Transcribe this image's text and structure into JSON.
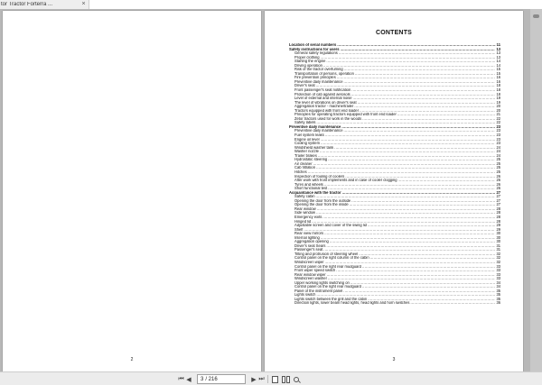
{
  "tab": {
    "title": "tor Tractor Forterra ...",
    "close": "×"
  },
  "left_page": {
    "number": "2"
  },
  "right_page": {
    "number": "3",
    "title": "CONTENTS",
    "toc": [
      {
        "text": "Location of serial numbers",
        "page": "11",
        "section": true,
        "indent": false
      },
      {
        "text": "Safety instructions for users",
        "page": "13",
        "section": true,
        "indent": false
      },
      {
        "text": "General safety regulations",
        "page": "13",
        "section": false,
        "indent": true
      },
      {
        "text": "Proper clothing",
        "page": "13",
        "section": false,
        "indent": true
      },
      {
        "text": "Starting the engine",
        "page": "14",
        "section": false,
        "indent": true
      },
      {
        "text": "Driving operation",
        "page": "14",
        "section": false,
        "indent": true
      },
      {
        "text": "Risk of the tractor overturning",
        "page": "15",
        "section": false,
        "indent": true
      },
      {
        "text": "Transportation of persons, operation",
        "page": "15",
        "section": false,
        "indent": true
      },
      {
        "text": "Fire prevention principles",
        "page": "16",
        "section": false,
        "indent": true
      },
      {
        "text": "Preventive daily maintenance",
        "page": "16",
        "section": false,
        "indent": true
      },
      {
        "text": "Driver's seat",
        "page": "18",
        "section": false,
        "indent": true
      },
      {
        "text": "Front passenger's seat notification",
        "page": "18",
        "section": false,
        "indent": true
      },
      {
        "text": "Protection of cab against aerosols",
        "page": "18",
        "section": false,
        "indent": true
      },
      {
        "text": "Level of external and internal noise",
        "page": "19",
        "section": false,
        "indent": true
      },
      {
        "text": "The level of vibrations on driver's seat",
        "page": "19",
        "section": false,
        "indent": true
      },
      {
        "text": "Aggregation tractor - machine/trailer",
        "page": "20",
        "section": false,
        "indent": true
      },
      {
        "text": "Tractors equipped with front end loader",
        "page": "20",
        "section": false,
        "indent": true
      },
      {
        "text": "Principles for operating tractors equipped with front end loader",
        "page": "21",
        "section": false,
        "indent": true
      },
      {
        "text": "Zetor tractors used for work in the woods",
        "page": "22",
        "section": false,
        "indent": true
      },
      {
        "text": "Safety labels",
        "page": "22",
        "section": false,
        "indent": true
      },
      {
        "text": "Preventive daily maintenance",
        "page": "23",
        "section": true,
        "indent": false
      },
      {
        "text": "Preventive daily maintenance",
        "page": "23",
        "section": false,
        "indent": true
      },
      {
        "text": "Fuel system leaks",
        "page": "23",
        "section": false,
        "indent": true
      },
      {
        "text": "Engine oil level",
        "page": "23",
        "section": false,
        "indent": true
      },
      {
        "text": "Cooling system",
        "page": "23",
        "section": false,
        "indent": true
      },
      {
        "text": "Windshield washer tank",
        "page": "24",
        "section": false,
        "indent": true
      },
      {
        "text": "Washer nozzle",
        "page": "24",
        "section": false,
        "indent": true
      },
      {
        "text": "Trailer brakes",
        "page": "24",
        "section": false,
        "indent": true
      },
      {
        "text": "Hydrostatic steering",
        "page": "25",
        "section": false,
        "indent": true
      },
      {
        "text": "Air cleaner",
        "page": "25",
        "section": false,
        "indent": true
      },
      {
        "text": "Cab filtration",
        "page": "25",
        "section": false,
        "indent": true
      },
      {
        "text": "Hitches",
        "page": "25",
        "section": false,
        "indent": true
      },
      {
        "text": "Inspection of fouling of coolers",
        "page": "26",
        "section": false,
        "indent": true
      },
      {
        "text": "After work with front implements and in case of cooler clogging",
        "page": "26",
        "section": false,
        "indent": true
      },
      {
        "text": "Tyres and wheels",
        "page": "26",
        "section": false,
        "indent": true
      },
      {
        "text": "Short functional test",
        "page": "26",
        "section": false,
        "indent": true
      },
      {
        "text": "Acquaintance with the tractor",
        "page": "27",
        "section": true,
        "indent": false
      },
      {
        "text": "Safety cabin",
        "page": "27",
        "section": false,
        "indent": true
      },
      {
        "text": "Opening the door from the outside",
        "page": "27",
        "section": false,
        "indent": true
      },
      {
        "text": "Opening the door from the inside",
        "page": "27",
        "section": false,
        "indent": true
      },
      {
        "text": "Rear window",
        "page": "28",
        "section": false,
        "indent": true
      },
      {
        "text": "Side window",
        "page": "28",
        "section": false,
        "indent": true
      },
      {
        "text": "Emergency exits",
        "page": "28",
        "section": false,
        "indent": true
      },
      {
        "text": "Hinged lid",
        "page": "28",
        "section": false,
        "indent": true
      },
      {
        "text": "Adjustable screen and cover of the swing lid",
        "page": "29",
        "section": false,
        "indent": true
      },
      {
        "text": "Shelf",
        "page": "29",
        "section": false,
        "indent": true
      },
      {
        "text": "Rear view mirrors",
        "page": "30",
        "section": false,
        "indent": true
      },
      {
        "text": "Internal lighting",
        "page": "30",
        "section": false,
        "indent": true
      },
      {
        "text": "Aggregation opening",
        "page": "30",
        "section": false,
        "indent": true
      },
      {
        "text": "Driver's seat Sears",
        "page": "31",
        "section": false,
        "indent": true
      },
      {
        "text": "Passenger's seat",
        "page": "31",
        "section": false,
        "indent": true
      },
      {
        "text": "Tilting and protrusion of steering wheel",
        "page": "32",
        "section": false,
        "indent": true
      },
      {
        "text": "Control panel on the right column of the cabin",
        "page": "32",
        "section": false,
        "indent": true
      },
      {
        "text": "Windscreen wiper",
        "page": "32",
        "section": false,
        "indent": true
      },
      {
        "text": "Control panel on the right rear mudguard",
        "page": "33",
        "section": false,
        "indent": true
      },
      {
        "text": "Front wiper speed switch",
        "page": "33",
        "section": false,
        "indent": true
      },
      {
        "text": "Rear window wiper",
        "page": "33",
        "section": false,
        "indent": true
      },
      {
        "text": "Windscreen washer",
        "page": "33",
        "section": false,
        "indent": true
      },
      {
        "text": "Upper working lights switching on",
        "page": "34",
        "section": false,
        "indent": true
      },
      {
        "text": "Control panel on the right rear mudguard",
        "page": "34",
        "section": false,
        "indent": true
      },
      {
        "text": "Panel of the instrument panel",
        "page": "35",
        "section": false,
        "indent": true
      },
      {
        "text": "Lights switch",
        "page": "35",
        "section": false,
        "indent": true
      },
      {
        "text": "Lights switch between the grill and the cabin",
        "page": "35",
        "section": false,
        "indent": true
      },
      {
        "text": "Direction lights, lower beam head lights, head lights and horn switches",
        "page": "36",
        "section": false,
        "indent": true
      }
    ]
  },
  "toolbar": {
    "first_icon": "⏮",
    "prev_icon": "◀",
    "next_icon": "▶",
    "last_icon": "⏭",
    "current_page": "3",
    "total_pages": "/ 216"
  }
}
